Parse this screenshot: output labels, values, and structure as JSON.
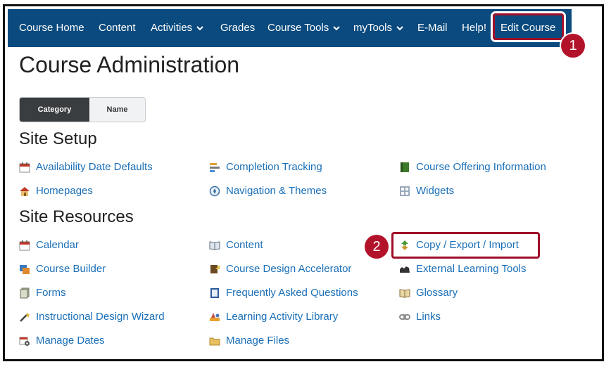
{
  "nav": {
    "items": [
      {
        "label": "Course Home"
      },
      {
        "label": "Content"
      },
      {
        "label": "Activities"
      },
      {
        "label": "Grades"
      },
      {
        "label": "Course Tools"
      },
      {
        "label": "myTools"
      },
      {
        "label": "E-Mail"
      },
      {
        "label": "Help!"
      }
    ],
    "edit_course": "Edit Course"
  },
  "callouts": {
    "one": "1",
    "two": "2"
  },
  "page_title": "Course Administration",
  "view_toggle": {
    "category": "Category",
    "name": "Name",
    "selected": "Category"
  },
  "colors": {
    "navbar": "#0a4a7e",
    "link": "#1a6fb8",
    "highlight": "#a00e2a",
    "badge": "#b3132a"
  },
  "sections": [
    {
      "title": "Site Setup",
      "tools": [
        {
          "label": "Availability Date Defaults",
          "icon": "calendar-icon"
        },
        {
          "label": "Completion Tracking",
          "icon": "completion-tracking-icon"
        },
        {
          "label": "Course Offering Information",
          "icon": "book-icon"
        },
        {
          "label": "Homepages",
          "icon": "home-icon"
        },
        {
          "label": "Navigation & Themes",
          "icon": "compass-icon"
        },
        {
          "label": "Widgets",
          "icon": "widgets-grid-icon"
        }
      ]
    },
    {
      "title": "Site Resources",
      "tools": [
        {
          "label": "Calendar",
          "icon": "calendar-icon"
        },
        {
          "label": "Content",
          "icon": "open-book-icon"
        },
        {
          "label": "Copy / Export / Import",
          "icon": "copy-arrows-icon"
        },
        {
          "label": "Course Builder",
          "icon": "course-builder-icon"
        },
        {
          "label": "Course Design Accelerator",
          "icon": "design-accelerator-icon"
        },
        {
          "label": "External Learning Tools",
          "icon": "puzzle-icon"
        },
        {
          "label": "Forms",
          "icon": "forms-icon"
        },
        {
          "label": "Frequently Asked Questions",
          "icon": "faq-book-icon"
        },
        {
          "label": "Glossary",
          "icon": "glossary-icon"
        },
        {
          "label": "Instructional Design Wizard",
          "icon": "wand-icon"
        },
        {
          "label": "Learning Activity Library",
          "icon": "library-icon"
        },
        {
          "label": "Links",
          "icon": "link-icon"
        },
        {
          "label": "Manage Dates",
          "icon": "calendar-gear-icon"
        },
        {
          "label": "Manage Files",
          "icon": "folder-icon"
        }
      ]
    }
  ]
}
